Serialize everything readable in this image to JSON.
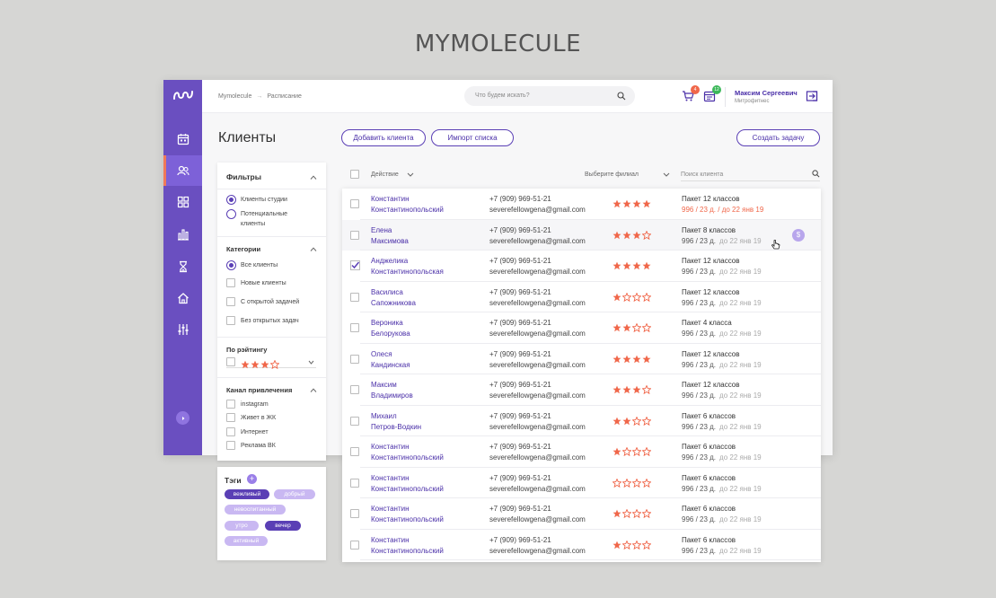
{
  "brand": "MYMOLECULE",
  "breadcrumb": [
    "Mymolecule",
    "→",
    "Расписание"
  ],
  "search": {
    "placeholder": "Что будем искать?"
  },
  "cart_badge": "4",
  "calendar_badge": "12",
  "user": {
    "name": "Максим Сергеевич",
    "org": "Митрофитнес"
  },
  "page_title": "Клиенты",
  "buttons": {
    "add_client": "Добавить клиента",
    "import_list": "Импорт списка",
    "create_task": "Создать задачу"
  },
  "filters": {
    "title": "Фильтры",
    "client_type": [
      {
        "label": "Клиенты студии",
        "selected": true
      },
      {
        "label": "Потенциальные клиенты",
        "selected": false
      }
    ],
    "categories_title": "Категории",
    "categories": [
      {
        "label": "Все клиенты",
        "type": "radio",
        "selected": true
      },
      {
        "label": "Новые клиенты",
        "type": "checkbox"
      },
      {
        "label": "С открытой задачей",
        "type": "checkbox"
      },
      {
        "label": "Без открытых задач",
        "type": "checkbox"
      }
    ],
    "rating_title": "По рэйтингу",
    "rating_value": 3,
    "channel_title": "Канал привлечения",
    "channels": [
      "instagram",
      "Живет в ЖК",
      "Интернет",
      "Реклама ВК"
    ]
  },
  "tags": {
    "title": "Тэги",
    "items": [
      {
        "label": "вежливый",
        "style": "dark"
      },
      {
        "label": "добрый",
        "style": "light"
      },
      {
        "label": "невоспитанный",
        "style": "light"
      },
      {
        "label": "утро",
        "style": "light"
      },
      {
        "label": "вечер",
        "style": "dark"
      },
      {
        "label": "активный",
        "style": "light"
      }
    ]
  },
  "list_header": {
    "action": "Действие",
    "branch": "Выберите филиал",
    "client_search": "Поиск клиента"
  },
  "clients": [
    {
      "first": "Константин",
      "last": "Константинопольский",
      "phone": "+7 (909) 969-51-21",
      "email": "severefellowgena@gmail.com",
      "rating": 4,
      "package": "Пакет 12 классов",
      "left": "996 / 23 д.",
      "until": "до 22 янв 19",
      "overdue": true,
      "checked": false,
      "hover": false
    },
    {
      "first": "Елена",
      "last": "Максимова",
      "phone": "+7 (909) 969-51-21",
      "email": "severefellowgena@gmail.com",
      "rating": 3,
      "package": "Пакет 8 классов",
      "left": "996 / 23 д.",
      "until": "до 22 янв 19",
      "overdue": false,
      "checked": false,
      "hover": true,
      "pay_icon": "$"
    },
    {
      "first": "Анджелика",
      "last": "Константинопольская",
      "phone": "+7 (909) 969-51-21",
      "email": "severefellowgena@gmail.com",
      "rating": 4,
      "package": "Пакет 12 классов",
      "left": "996 / 23 д.",
      "until": "до 22 янв 19",
      "overdue": false,
      "checked": true,
      "hover": false
    },
    {
      "first": "Василиса",
      "last": "Сапожникова",
      "phone": "+7 (909) 969-51-21",
      "email": "severefellowgena@gmail.com",
      "rating": 1,
      "package": "Пакет 12 классов",
      "left": "996 / 23 д.",
      "until": "до 22 янв 19",
      "overdue": false,
      "checked": false,
      "hover": false
    },
    {
      "first": "Вероника",
      "last": "Белорукова",
      "phone": "+7 (909) 969-51-21",
      "email": "severefellowgena@gmail.com",
      "rating": 2,
      "package": "Пакет 4 класса",
      "left": "996 / 23 д.",
      "until": "до 22 янв 19",
      "overdue": false,
      "checked": false,
      "hover": false
    },
    {
      "first": "Олеся",
      "last": "Кандинская",
      "phone": "+7 (909) 969-51-21",
      "email": "severefellowgena@gmail.com",
      "rating": 4,
      "package": "Пакет 12 классов",
      "left": "996 / 23 д.",
      "until": "до 22 янв 19",
      "overdue": false,
      "checked": false,
      "hover": false
    },
    {
      "first": "Максим",
      "last": "Владимиров",
      "phone": "+7 (909) 969-51-21",
      "email": "severefellowgena@gmail.com",
      "rating": 3,
      "package": "Пакет 12 классов",
      "left": "996 / 23 д.",
      "until": "до 22 янв 19",
      "overdue": false,
      "checked": false,
      "hover": false
    },
    {
      "first": "Михаил",
      "last": "Петров-Водкин",
      "phone": "+7 (909) 969-51-21",
      "email": "severefellowgena@gmail.com",
      "rating": 2,
      "package": "Пакет 6 классов",
      "left": "996 / 23 д.",
      "until": "до 22 янв 19",
      "overdue": false,
      "checked": false,
      "hover": false
    },
    {
      "first": "Константин",
      "last": "Константинопольский",
      "phone": "+7 (909) 969-51-21",
      "email": "severefellowgena@gmail.com",
      "rating": 1,
      "package": "Пакет 6 классов",
      "left": "996 / 23 д.",
      "until": "до 22 янв 19",
      "overdue": false,
      "checked": false,
      "hover": false
    },
    {
      "first": "Константин",
      "last": "Константинопольский",
      "phone": "+7 (909) 969-51-21",
      "email": "severefellowgena@gmail.com",
      "rating": 0,
      "package": "Пакет 6 классов",
      "left": "996 / 23 д.",
      "until": "до 22 янв 19",
      "overdue": false,
      "checked": false,
      "hover": false
    },
    {
      "first": "Константин",
      "last": "Константинопольский",
      "phone": "+7 (909) 969-51-21",
      "email": "severefellowgena@gmail.com",
      "rating": 1,
      "package": "Пакет 6 классов",
      "left": "996 / 23 д.",
      "until": "до 22 янв 19",
      "overdue": false,
      "checked": false,
      "hover": false
    },
    {
      "first": "Константин",
      "last": "Константинопольский",
      "phone": "+7 (909) 969-51-21",
      "email": "severefellowgena@gmail.com",
      "rating": 1,
      "package": "Пакет 6 классов",
      "left": "996 / 23 д.",
      "until": "до 22 янв 19",
      "overdue": false,
      "checked": false,
      "hover": false
    }
  ],
  "colors": {
    "accent": "#6a4fc0",
    "link": "#4a2fa8",
    "star": "#f0674a",
    "overdue": "#f0674a"
  },
  "icons": {
    "sidebar": [
      "calendar-icon",
      "clients-icon",
      "dashboard-icon",
      "stats-icon",
      "hourglass-icon",
      "home-icon",
      "settings-sliders-icon"
    ]
  }
}
